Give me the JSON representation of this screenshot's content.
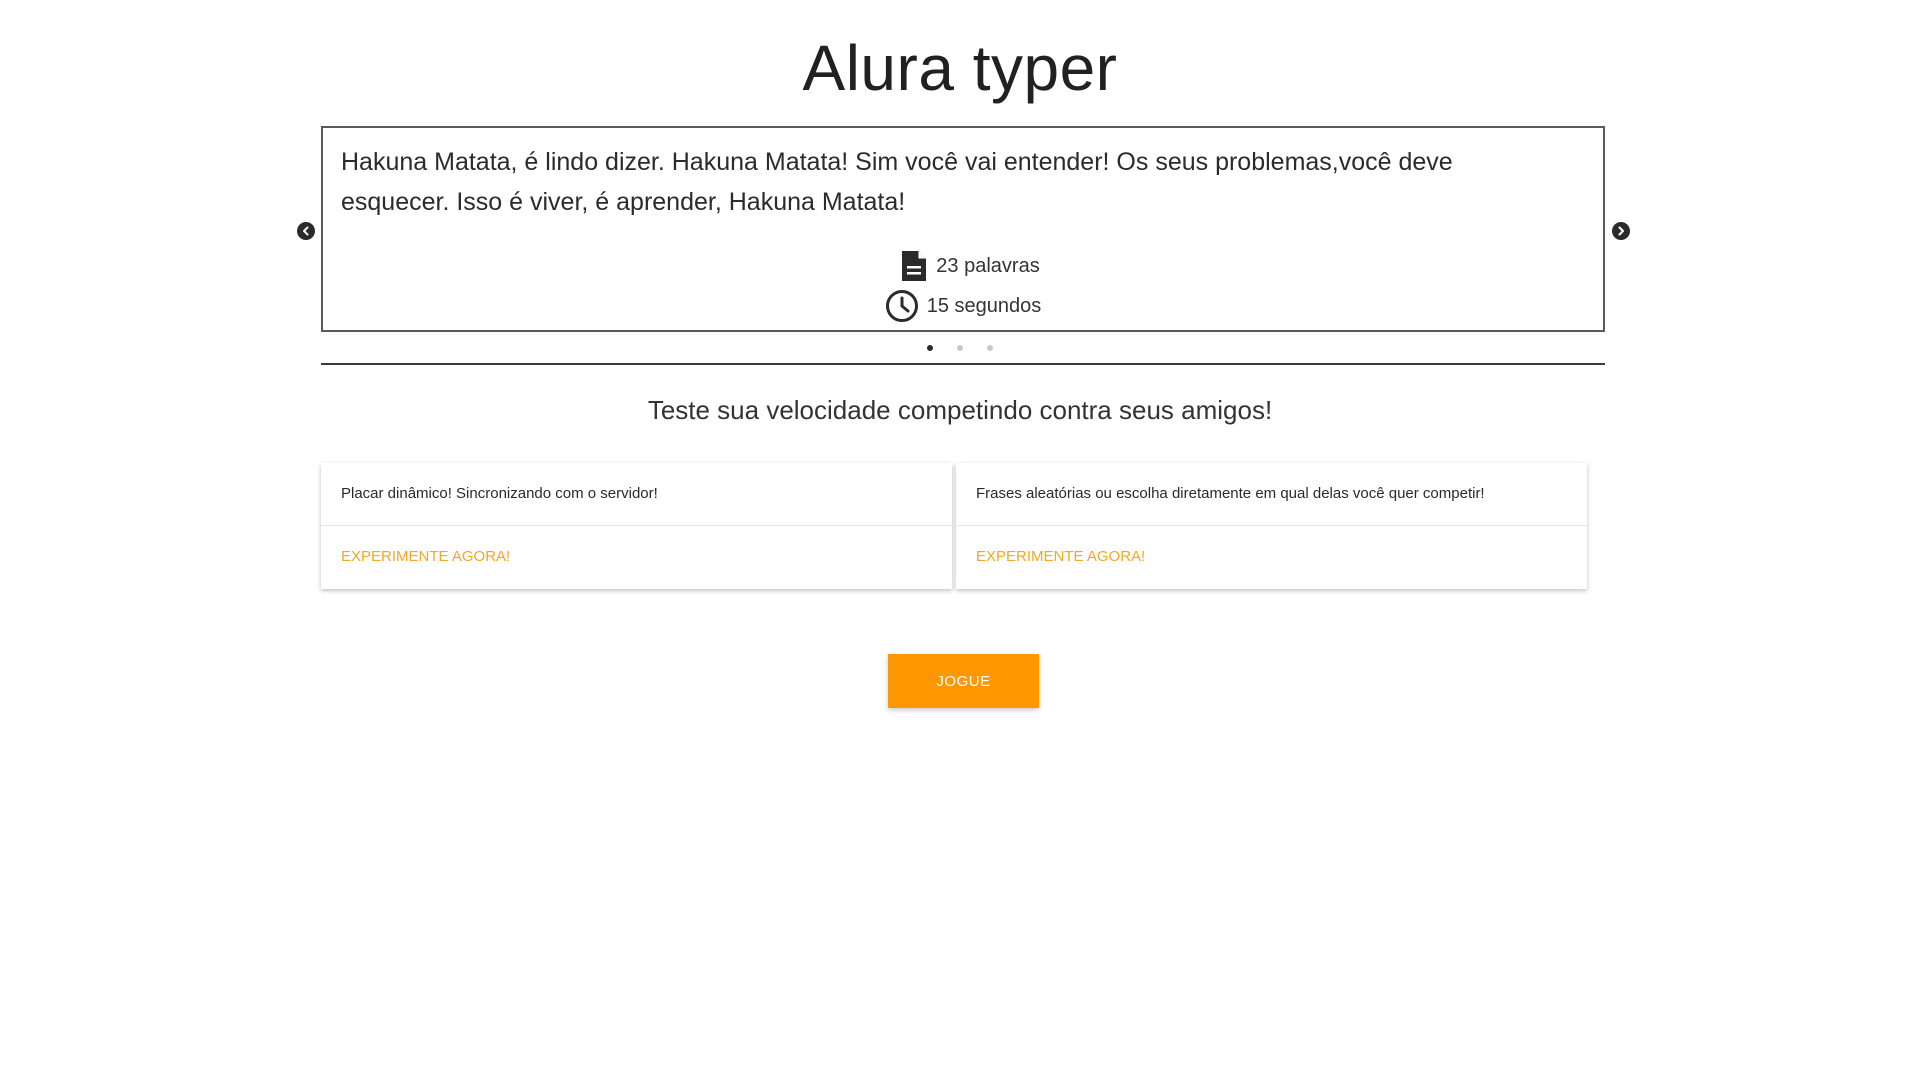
{
  "page": {
    "title": "Alura typer",
    "subtitle": "Teste sua velocidade competindo contra seus amigos!"
  },
  "carousel": {
    "active_index": 0,
    "slide_count": 3,
    "slide": {
      "text": "Hakuna Matata, é lindo dizer. Hakuna Matata! Sim você vai entender! Os seus problemas,você deve esquecer. Isso é viver, é aprender, Hakuna Matata!",
      "words": "23 palavras",
      "time": "15 segundos"
    },
    "icons": {
      "prev": "chevron-left-circle-icon",
      "next": "chevron-right-circle-icon",
      "words": "document-icon",
      "time": "clock-icon"
    }
  },
  "cards": [
    {
      "content": "Placar dinâmico! Sincronizando com o servidor!",
      "action": "EXPERIMENTE AGORA!"
    },
    {
      "content": "Frases aleatórias ou escolha diretamente em qual delas você quer competir!",
      "action": "EXPERIMENTE AGORA!"
    }
  ],
  "play_button": {
    "label": "JOGUE"
  },
  "colors": {
    "accent": "#ff9800",
    "link": "#f5a623",
    "text": "#212121"
  }
}
